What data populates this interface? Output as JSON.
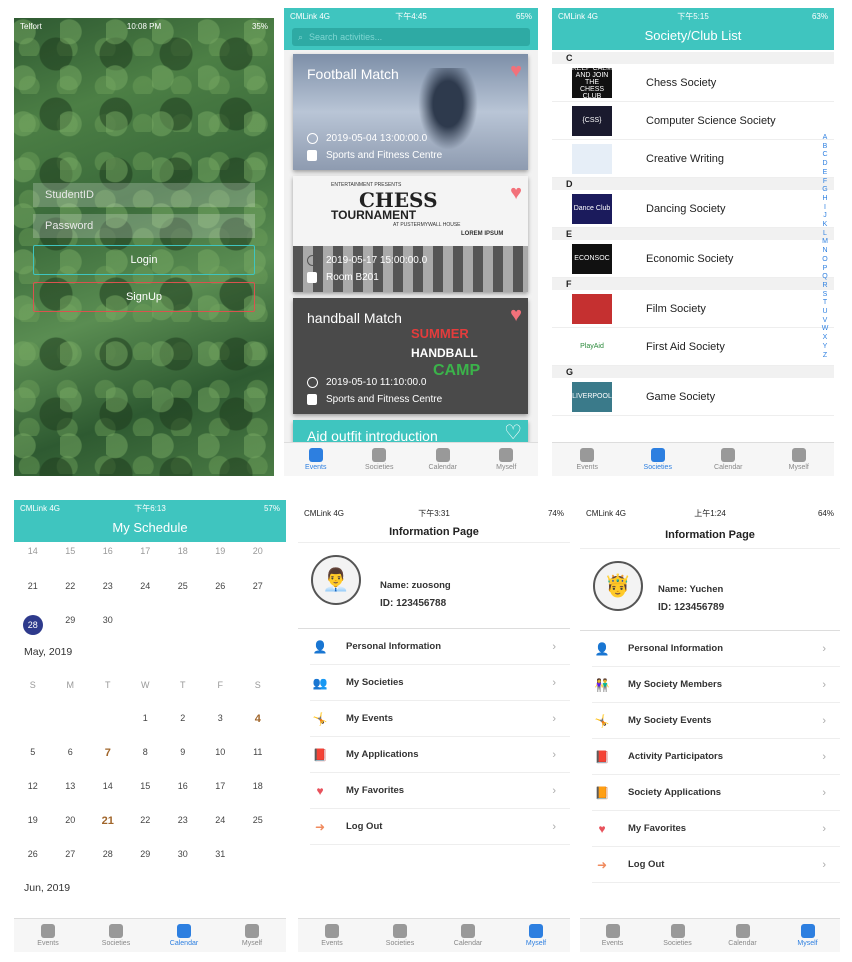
{
  "login": {
    "status_left": "Telfort",
    "status_time": "10:08 PM",
    "status_right": "35%",
    "student_placeholder": "StudentID",
    "password_placeholder": "Password",
    "login_label": "Login",
    "signup_label": "SignUp",
    "login_color": "#3fc5bf",
    "signup_color": "#d9534f"
  },
  "events": {
    "status_left": "CMLink 4G",
    "status_time": "下午4:45",
    "status_right": "65%",
    "search_placeholder": "Search activities...",
    "cards": [
      {
        "title": "Football Match",
        "date": "2019-05-04 13:00:00.0",
        "location": "Sports and Fitness Centre",
        "favorited": true
      },
      {
        "title": "",
        "date": "2019-05-17 15:00:00.0",
        "location": "Room B201",
        "favorited": true
      },
      {
        "title": "handball Match",
        "date": "2019-05-10 11:10:00.0",
        "location": "Sports and Fitness Centre",
        "favorited": true
      },
      {
        "title": "Aid outfit introduction",
        "favorited": false
      }
    ]
  },
  "chess_card": {
    "top": "ENTERTAINMENT PRESENTS",
    "name": "CHESS",
    "sub": "TOURNAMENT",
    "place": "AT PUSTERMYWALL HOUSE",
    "lorem": "LOREM IPSUM"
  },
  "handball_card": {
    "summer": "SUMMER",
    "handball": "HANDBALL",
    "camp": "CAMP"
  },
  "clubs": {
    "status_left": "CMLink 4G",
    "status_time": "下午5:15",
    "status_right": "63%",
    "title": "Society/Club List",
    "sections": [
      {
        "letter": "C",
        "items": [
          {
            "name": "Chess Society",
            "logo": "KEEP CALM AND JOIN THE CHESS CLUB"
          },
          {
            "name": "Computer Science Society",
            "logo": "{CSS}"
          },
          {
            "name": "Creative Writing",
            "logo": ""
          }
        ]
      },
      {
        "letter": "D",
        "items": [
          {
            "name": "Dancing Society",
            "logo": "Dance Club"
          }
        ]
      },
      {
        "letter": "E",
        "items": [
          {
            "name": "Economic Society",
            "logo": "ECONSOC"
          }
        ]
      },
      {
        "letter": "F",
        "items": [
          {
            "name": "Film Society",
            "logo": ""
          },
          {
            "name": "First Aid Society",
            "logo": "PlayAid"
          }
        ]
      },
      {
        "letter": "G",
        "items": [
          {
            "name": "Game Society",
            "logo": "LIVERPOOL"
          }
        ]
      }
    ],
    "alphabet": [
      "A",
      "B",
      "C",
      "D",
      "E",
      "F",
      "G",
      "H",
      "I",
      "J",
      "K",
      "L",
      "M",
      "N",
      "O",
      "P",
      "Q",
      "R",
      "S",
      "T",
      "U",
      "V",
      "W",
      "X",
      "Y",
      "Z"
    ]
  },
  "schedule": {
    "status_left": "CMLink 4G",
    "status_time": "下午6:13",
    "status_right": "57%",
    "title": "My Schedule",
    "top_row": [
      "14",
      "15",
      "16",
      "17",
      "18",
      "19",
      "20"
    ],
    "row1": [
      "21",
      "22",
      "23",
      "24",
      "25",
      "26",
      "27"
    ],
    "row2": [
      "28",
      "29",
      "30",
      "",
      "",
      "",
      ""
    ],
    "may": "May, 2019",
    "weekdays": [
      "S",
      "M",
      "T",
      "W",
      "T",
      "F",
      "S"
    ],
    "weeks": [
      [
        "",
        "",
        "",
        "1",
        "2",
        "3",
        "4"
      ],
      [
        "5",
        "6",
        "7",
        "8",
        "9",
        "10",
        "11"
      ],
      [
        "12",
        "13",
        "14",
        "15",
        "16",
        "17",
        "18"
      ],
      [
        "19",
        "20",
        "21",
        "22",
        "23",
        "24",
        "25"
      ],
      [
        "26",
        "27",
        "28",
        "29",
        "30",
        "31",
        ""
      ]
    ],
    "jun": "Jun, 2019"
  },
  "info1": {
    "status_left": "CMLink 4G",
    "status_time": "下午3:31",
    "status_right": "74%",
    "title": "Information Page",
    "name": "Name: zuosong",
    "id": "ID: 123456788",
    "items": [
      "Personal Information",
      "My Societies",
      "My Events",
      "My Applications",
      "My Favorites",
      "Log Out"
    ]
  },
  "info2": {
    "status_left": "CMLink 4G",
    "status_time": "上午1:24",
    "status_right": "64%",
    "title": "Information Page",
    "name": "Name: Yuchen",
    "id": "ID: 123456789",
    "items": [
      "Personal Information",
      "My Society Members",
      "My Society Events",
      "Activity Participators",
      "Society Applications",
      "My Favorites",
      "Log Out"
    ]
  },
  "tabs": {
    "events": "Events",
    "societies": "Societies",
    "calendar": "Calendar",
    "myself": "Myself"
  }
}
